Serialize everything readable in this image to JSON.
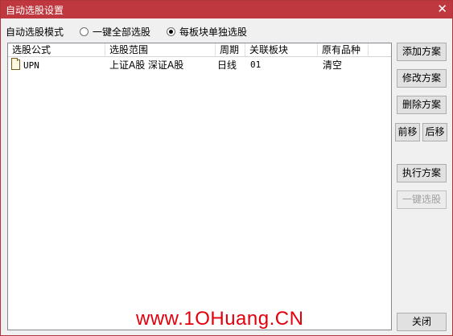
{
  "window": {
    "title": "自动选股设置",
    "close_glyph": "✕"
  },
  "mode": {
    "label": "自动选股模式",
    "options": [
      {
        "label": "一键全部选股",
        "checked": false
      },
      {
        "label": "每板块单独选股",
        "checked": true
      }
    ]
  },
  "table": {
    "columns": [
      "选股公式",
      "选股范围",
      "周期",
      "关联板块",
      "原有品种"
    ],
    "rows": [
      {
        "formula": "UPN",
        "range": "上证A股 深证A股",
        "period": "日线",
        "sector": "01",
        "original": "清空"
      }
    ]
  },
  "buttons": {
    "add": "添加方案",
    "edit": "修改方案",
    "delete": "删除方案",
    "move_up": "前移",
    "move_down": "后移",
    "execute": "执行方案",
    "one_click": "一键选股",
    "close": "关闭"
  },
  "watermark": "www.1OHuang.CN"
}
